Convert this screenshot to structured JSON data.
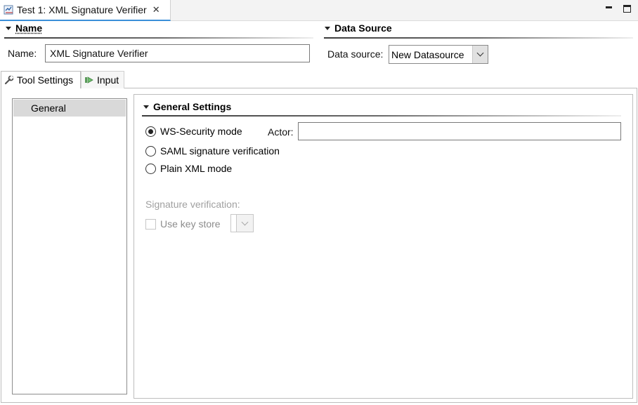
{
  "editor": {
    "tab_title": "Test 1: XML Signature Verifier",
    "close_glyph": "✕"
  },
  "name_section": {
    "title": "Name",
    "name_label": "Name:",
    "name_value": "XML Signature Verifier"
  },
  "datasource_section": {
    "title": "Data Source",
    "label": "Data source:",
    "selected": "New Datasource"
  },
  "tabs": [
    {
      "label": "Tool Settings",
      "icon": "wrench-icon",
      "active": true
    },
    {
      "label": "Input",
      "icon": "input-arrow-icon",
      "active": false
    }
  ],
  "nav": {
    "items": [
      {
        "label": "General",
        "selected": true
      }
    ]
  },
  "general": {
    "title": "General Settings",
    "modes": [
      {
        "label": "WS-Security mode",
        "checked": true
      },
      {
        "label": "SAML signature verification",
        "checked": false
      },
      {
        "label": "Plain XML mode",
        "checked": false
      }
    ],
    "actor_label": "Actor:",
    "actor_value": "",
    "signature_verification_label": "Signature verification:",
    "use_key_store_label": "Use key store",
    "use_key_store_checked": false
  },
  "colors": {
    "active_tab_accent": "#3a8fd8",
    "selected_nav_bg": "#d9d9d9",
    "disabled_text": "#a0a0a0"
  }
}
